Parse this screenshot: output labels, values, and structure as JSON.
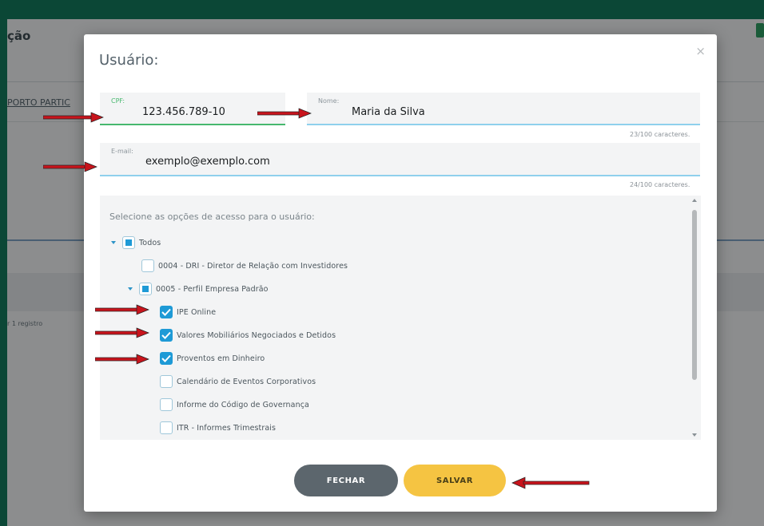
{
  "background": {
    "page_title_partial": "ção",
    "field_partial": "PORTO PARTIC",
    "records_partial": "r 1 registro"
  },
  "modal": {
    "title": "Usuário:",
    "close_symbol": "×",
    "cpf": {
      "label": "CPF:",
      "value": "123.456.789-10"
    },
    "nome": {
      "label": "Nome:",
      "value": "Maria da Silva",
      "char_count": "23/100 caracteres."
    },
    "email": {
      "label": "E-mail:",
      "value": "exemplo@exemplo.com",
      "char_count": "24/100 caracteres."
    },
    "access": {
      "title": "Selecione as opções de acesso para o usuário:",
      "items": [
        {
          "label": "Todos",
          "state": "partial",
          "expandable": true
        },
        {
          "label": "0004 - DRI - Diretor de Relação com Investidores",
          "state": "unchecked"
        },
        {
          "label": "0005 - Perfil Empresa Padrão",
          "state": "partial",
          "expandable": true
        },
        {
          "label": "IPE Online",
          "state": "checked"
        },
        {
          "label": "Valores Mobiliários Negociados e Detidos",
          "state": "checked"
        },
        {
          "label": "Proventos em Dinheiro",
          "state": "checked"
        },
        {
          "label": "Calendário de Eventos Corporativos",
          "state": "unchecked"
        },
        {
          "label": "Informe do Código de Governança",
          "state": "unchecked"
        },
        {
          "label": "ITR - Informes Trimestrais",
          "state": "unchecked"
        }
      ]
    },
    "buttons": {
      "close": "FECHAR",
      "save": "SALVAR"
    }
  },
  "colors": {
    "frame": "#137a5d",
    "accent_blue": "#1e9ad6",
    "field_green": "#47b86e",
    "save_yellow": "#f5c442",
    "close_gray": "#5c666d",
    "arrow_red": "#c8141c"
  }
}
